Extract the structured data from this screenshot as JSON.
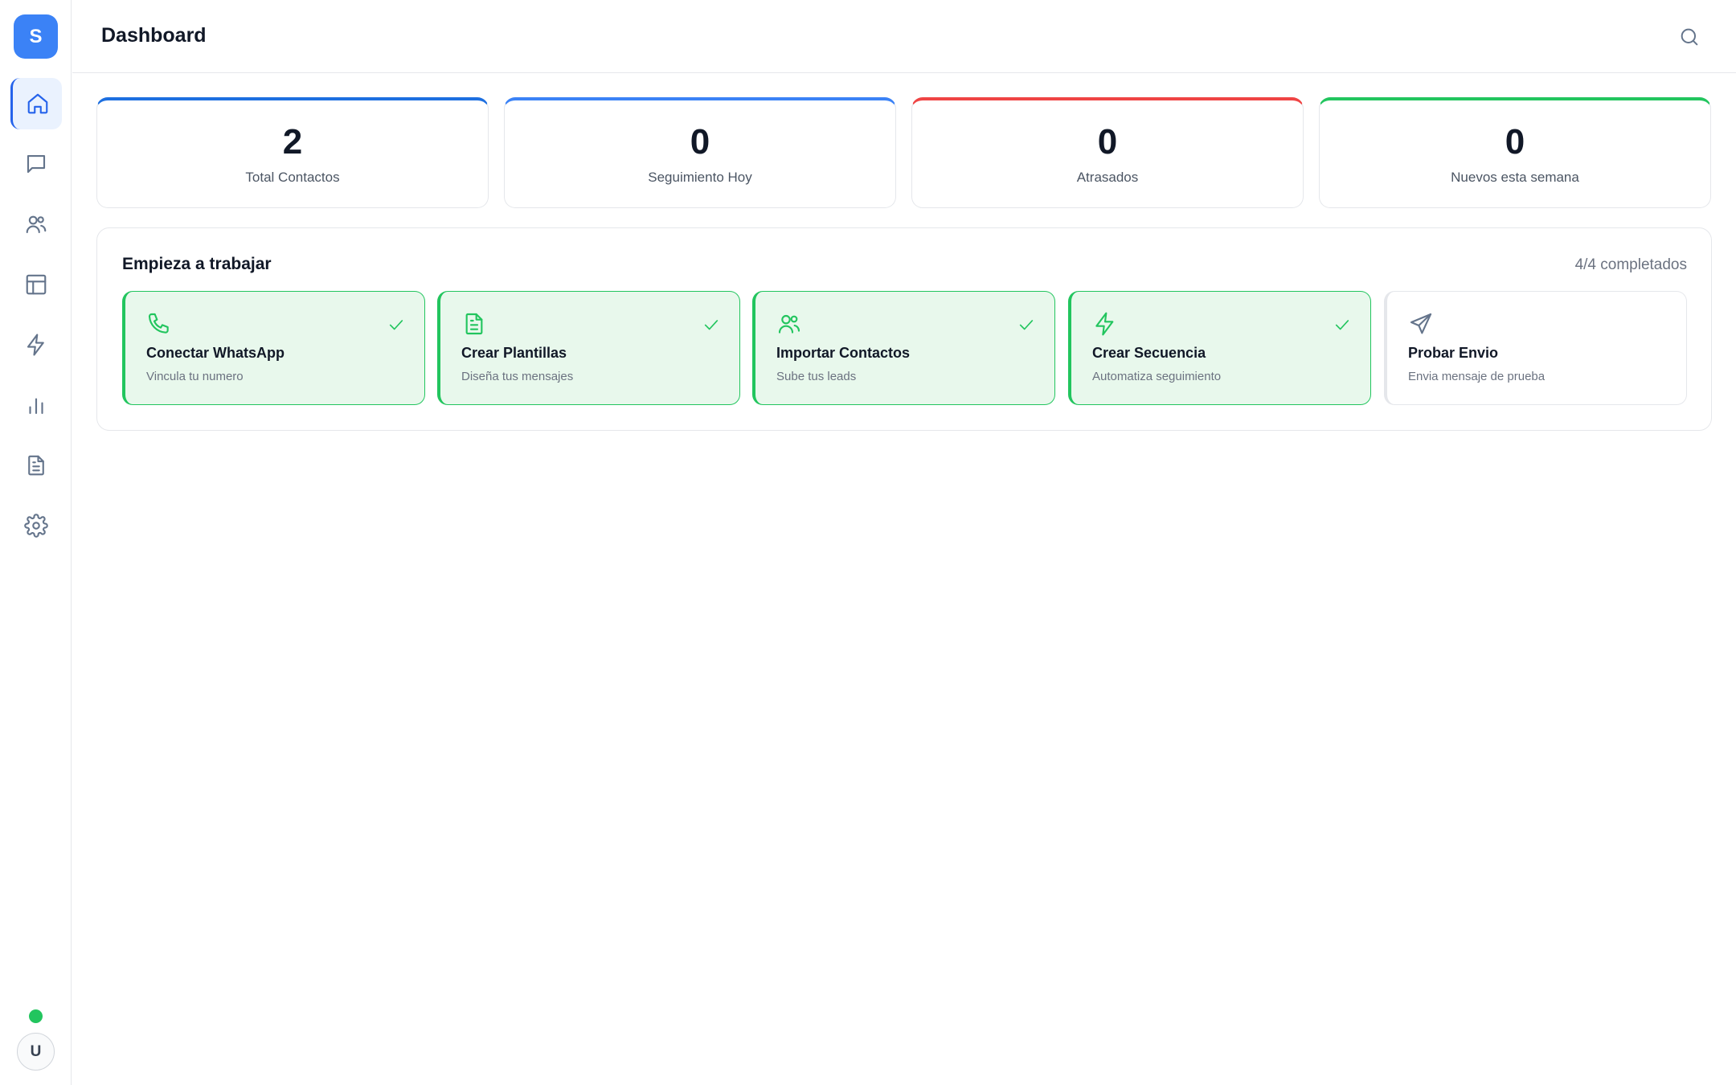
{
  "app": {
    "logo_letter": "S"
  },
  "header": {
    "title": "Dashboard",
    "search_icon": "search-icon"
  },
  "sidebar": {
    "items": [
      {
        "name": "home",
        "icon": "home-icon",
        "active": true
      },
      {
        "name": "messages",
        "icon": "chat-icon",
        "active": false
      },
      {
        "name": "contacts",
        "icon": "users-icon",
        "active": false
      },
      {
        "name": "table",
        "icon": "table-icon",
        "active": false
      },
      {
        "name": "automations",
        "icon": "bolt-icon",
        "active": false
      },
      {
        "name": "analytics",
        "icon": "bar-chart-icon",
        "active": false
      },
      {
        "name": "templates",
        "icon": "document-icon",
        "active": false
      },
      {
        "name": "settings",
        "icon": "gear-icon",
        "active": false
      }
    ],
    "status": "online",
    "user_initial": "U"
  },
  "stats": [
    {
      "value": "2",
      "label": "Total Contactos",
      "color": "#1d6fe0"
    },
    {
      "value": "0",
      "label": "Seguimiento Hoy",
      "color": "#3b82f6"
    },
    {
      "value": "0",
      "label": "Atrasados",
      "color": "#ef4444"
    },
    {
      "value": "0",
      "label": "Nuevos esta semana",
      "color": "#22c55e"
    }
  ],
  "onboarding": {
    "title": "Empieza a trabajar",
    "progress": "4/4 completados",
    "steps": [
      {
        "title": "Conectar WhatsApp",
        "desc": "Vincula tu numero",
        "icon": "phone-icon",
        "done": true
      },
      {
        "title": "Crear Plantillas",
        "desc": "Diseña tus mensajes",
        "icon": "document-icon",
        "done": true
      },
      {
        "title": "Importar Contactos",
        "desc": "Sube tus leads",
        "icon": "users-icon",
        "done": true
      },
      {
        "title": "Crear Secuencia",
        "desc": "Automatiza seguimiento",
        "icon": "bolt-icon",
        "done": true
      },
      {
        "title": "Probar Envio",
        "desc": "Envia mensaje de prueba",
        "icon": "send-icon",
        "done": false
      }
    ]
  },
  "colors": {
    "accent": "#3b82f6",
    "success": "#22c55e",
    "danger": "#ef4444"
  }
}
